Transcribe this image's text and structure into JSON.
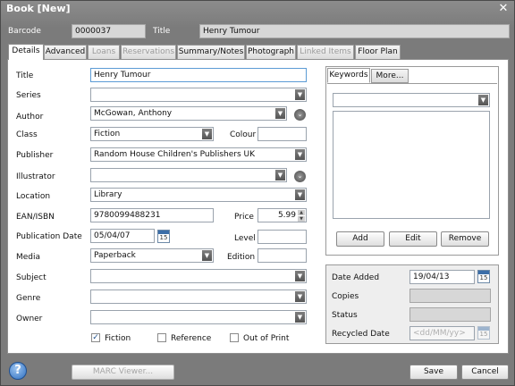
{
  "window": {
    "title": "Book [New]",
    "close_glyph": "✕"
  },
  "header": {
    "barcode_label": "Barcode",
    "barcode_value": "0000037",
    "title_label": "Title",
    "title_value": "Henry Tumour"
  },
  "tabs": [
    {
      "label": "Details",
      "active": true,
      "enabled": true
    },
    {
      "label": "Advanced",
      "active": false,
      "enabled": true
    },
    {
      "label": "Loans",
      "active": false,
      "enabled": false
    },
    {
      "label": "Reservations",
      "active": false,
      "enabled": false
    },
    {
      "label": "Summary/Notes",
      "active": false,
      "enabled": true
    },
    {
      "label": "Photograph",
      "active": false,
      "enabled": true
    },
    {
      "label": "Linked Items",
      "active": false,
      "enabled": false
    },
    {
      "label": "Floor Plan",
      "active": false,
      "enabled": true
    }
  ],
  "form": {
    "title": {
      "label": "Title",
      "value": "Henry Tumour"
    },
    "series": {
      "label": "Series",
      "value": ""
    },
    "author": {
      "label": "Author",
      "value": "McGowan, Anthony"
    },
    "class": {
      "label": "Class",
      "value": "Fiction"
    },
    "colour": {
      "label": "Colour",
      "value": ""
    },
    "publisher": {
      "label": "Publisher",
      "value": "Random House Children's Publishers UK"
    },
    "illustrator": {
      "label": "Illustrator",
      "value": ""
    },
    "location": {
      "label": "Location",
      "value": "Library"
    },
    "ean": {
      "label": "EAN/ISBN",
      "value": "9780099488231"
    },
    "price": {
      "label": "Price",
      "value": "5.99"
    },
    "pub_date": {
      "label": "Publication Date",
      "value": "05/04/07"
    },
    "level": {
      "label": "Level",
      "value": ""
    },
    "media": {
      "label": "Media",
      "value": "Paperback"
    },
    "edition": {
      "label": "Edition",
      "value": ""
    },
    "subject": {
      "label": "Subject",
      "value": ""
    },
    "genre": {
      "label": "Genre",
      "value": ""
    },
    "owner": {
      "label": "Owner",
      "value": ""
    },
    "fiction": {
      "label": "Fiction",
      "checked": true
    },
    "reference": {
      "label": "Reference",
      "checked": false
    },
    "out_of_print": {
      "label": "Out of Print",
      "checked": false
    }
  },
  "keywords": {
    "tab_keywords": "Keywords",
    "tab_more": "More...",
    "selected": "",
    "add": "Add",
    "edit": "Edit",
    "remove": "Remove"
  },
  "dates": {
    "date_added_label": "Date Added",
    "date_added_value": "19/04/13",
    "copies_label": "Copies",
    "status_label": "Status",
    "recycled_label": "Recycled Date",
    "recycled_placeholder": "<dd/MM/yy>"
  },
  "calendar_glyph": "15",
  "footer": {
    "help_glyph": "?",
    "marc": "MARC Viewer...",
    "save": "Save",
    "cancel": "Cancel"
  },
  "icons": {
    "dropdown": "▼",
    "expand": "⌄",
    "check": "✓",
    "spin_up": "▲",
    "spin_down": "▼"
  },
  "colors": {
    "window_gray": "#7b7b7b",
    "accent_blue": "#2f6fbf",
    "title_text": "#ffffff"
  }
}
